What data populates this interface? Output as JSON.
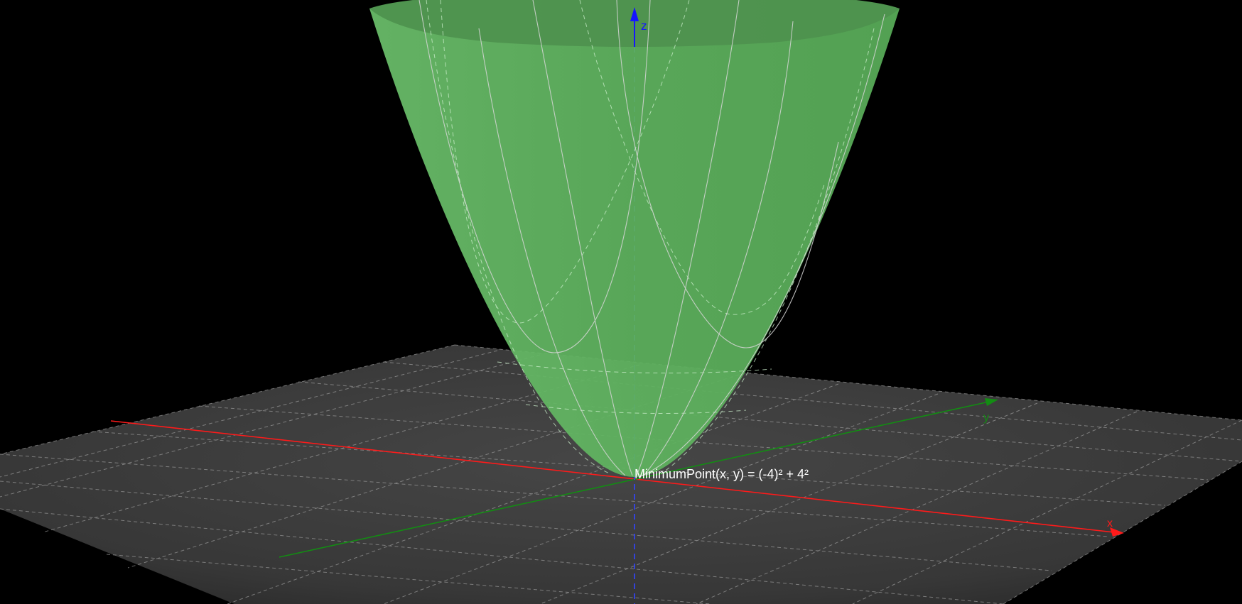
{
  "scene": {
    "background_color": "#000000",
    "surface_color": "#5cb05c",
    "plane_color": "#333333",
    "grid_color": "#9a9a9a",
    "axes": {
      "x": {
        "label": "x",
        "color": "#ff1a1a"
      },
      "y": {
        "label": "y",
        "color": "#138c13"
      },
      "z": {
        "label": "z",
        "color": "#1515ff"
      }
    },
    "surface_label": "MinimumPoint(x, y) = (-4)² + 4²",
    "surface_label_color": "#ffffff"
  }
}
